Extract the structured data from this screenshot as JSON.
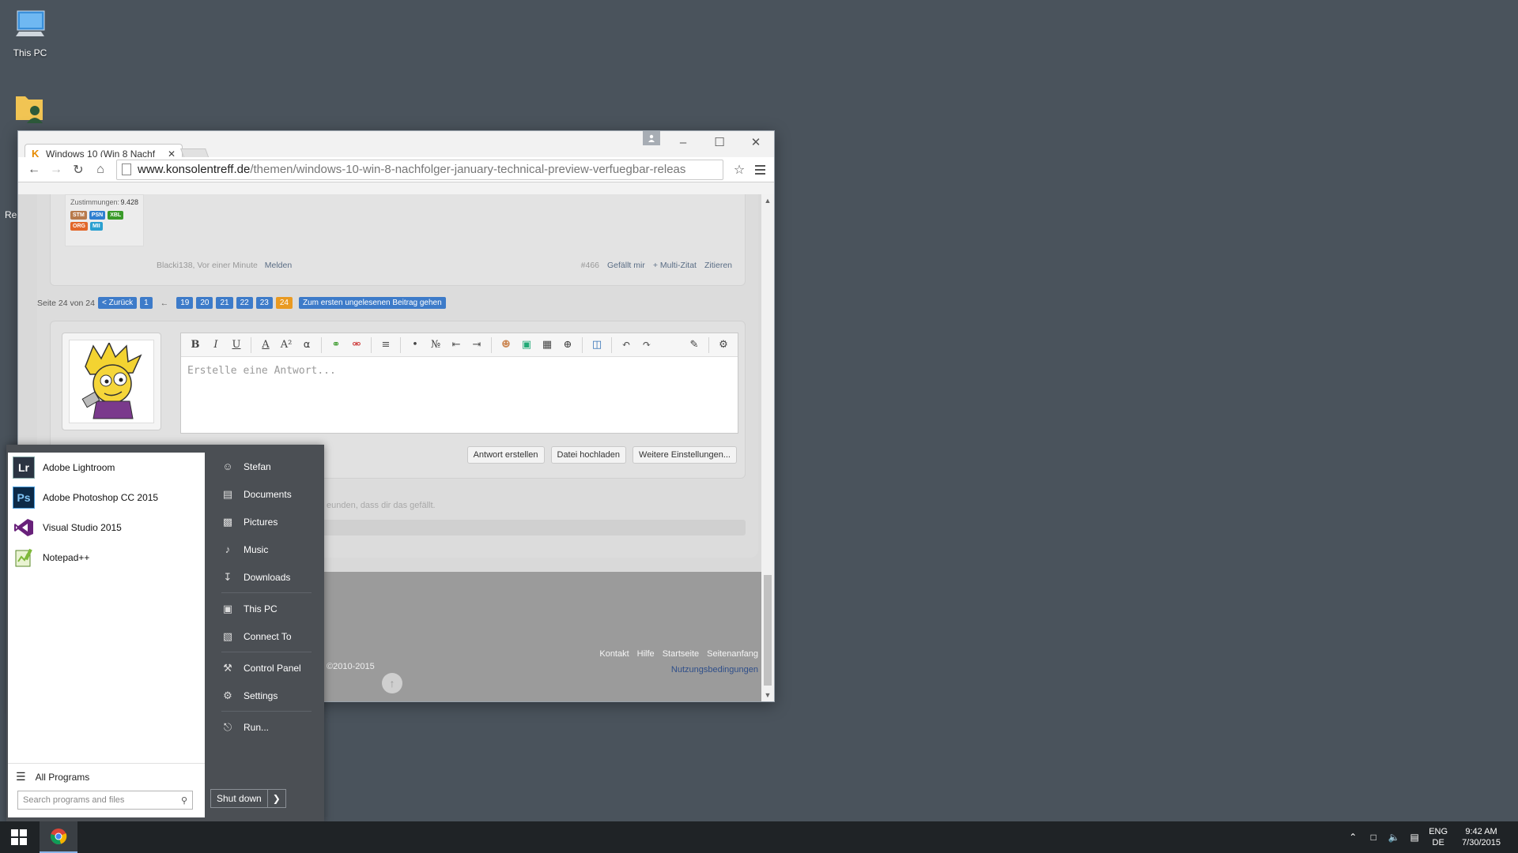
{
  "desktop": {
    "icons": [
      {
        "label": "This PC"
      },
      {
        "label": ""
      }
    ],
    "edge_label": "Re"
  },
  "browser": {
    "tab_title": "Windows 10 (Win 8 Nachf",
    "url_host": "www.konsolentreff.de",
    "url_path": "/themen/windows-10-win-8-nachfolger-january-technical-preview-verfuegbar-releas"
  },
  "post": {
    "user_stat_label": "Zustimmungen:",
    "user_stat_value": "9.428",
    "badges": [
      {
        "label": "STM",
        "color": "#b87a4b"
      },
      {
        "label": "PSN",
        "color": "#2f7fd0"
      },
      {
        "label": "XBL",
        "color": "#3a9a2a"
      },
      {
        "label": "ORG",
        "color": "#e2672a"
      },
      {
        "label": "MII",
        "color": "#2aa0d0"
      }
    ],
    "meta": "Blacki138, Vor einer Minute",
    "report": "Melden",
    "number": "#466",
    "like": "Gefällt mir",
    "multiquote": "+ Multi-Zitat",
    "quote": "Zitieren"
  },
  "pager": {
    "label": "Seite 24 von 24",
    "prev": "< Zurück",
    "first": "1",
    "pages": [
      "19",
      "20",
      "21",
      "22",
      "23"
    ],
    "current": "24",
    "unread": "Zum ersten ungelesenen Beitrag gehen"
  },
  "reply": {
    "placeholder": "Erstelle eine Antwort...",
    "post_btn": "Antwort erstellen",
    "upload_btn": "Datei hochladen",
    "more_btn": "Weitere Einstellungen...",
    "like_note": "eunden, dass dir das gefällt."
  },
  "footer": {
    "links": [
      "Kontakt",
      "Hilfe",
      "Startseite",
      "Seitenanfang"
    ],
    "terms": "Nutzungsbedingungen",
    "copyright": "©2010-2015"
  },
  "startmenu": {
    "apps": [
      {
        "label": "Adobe Lightroom",
        "icon": "Lr",
        "color": "#2b3442"
      },
      {
        "label": "Adobe Photoshop CC 2015",
        "icon": "Ps",
        "color": "#0c2a48"
      },
      {
        "label": "Visual Studio 2015",
        "icon": "VS",
        "color": "#68217a"
      },
      {
        "label": "Notepad++",
        "icon": "N++",
        "color": "#7fb93a"
      }
    ],
    "all_programs": "All Programs",
    "search_placeholder": "Search programs and files",
    "links": [
      {
        "label": "Stefan",
        "icon": "user-icon"
      },
      {
        "label": "Documents",
        "icon": "documents-icon"
      },
      {
        "label": "Pictures",
        "icon": "pictures-icon"
      },
      {
        "label": "Music",
        "icon": "music-icon"
      },
      {
        "label": "Downloads",
        "icon": "downloads-icon"
      },
      {
        "label": "This PC",
        "icon": "computer-icon"
      },
      {
        "label": "Connect To",
        "icon": "connect-icon"
      },
      {
        "label": "Control Panel",
        "icon": "control-panel-icon"
      },
      {
        "label": "Settings",
        "icon": "gear-icon"
      },
      {
        "label": "Run...",
        "icon": "run-icon"
      }
    ],
    "shutdown": "Shut down"
  },
  "taskbar": {
    "lang_top": "ENG",
    "lang_bottom": "DE",
    "time": "9:42 AM",
    "date": "7/30/2015"
  }
}
